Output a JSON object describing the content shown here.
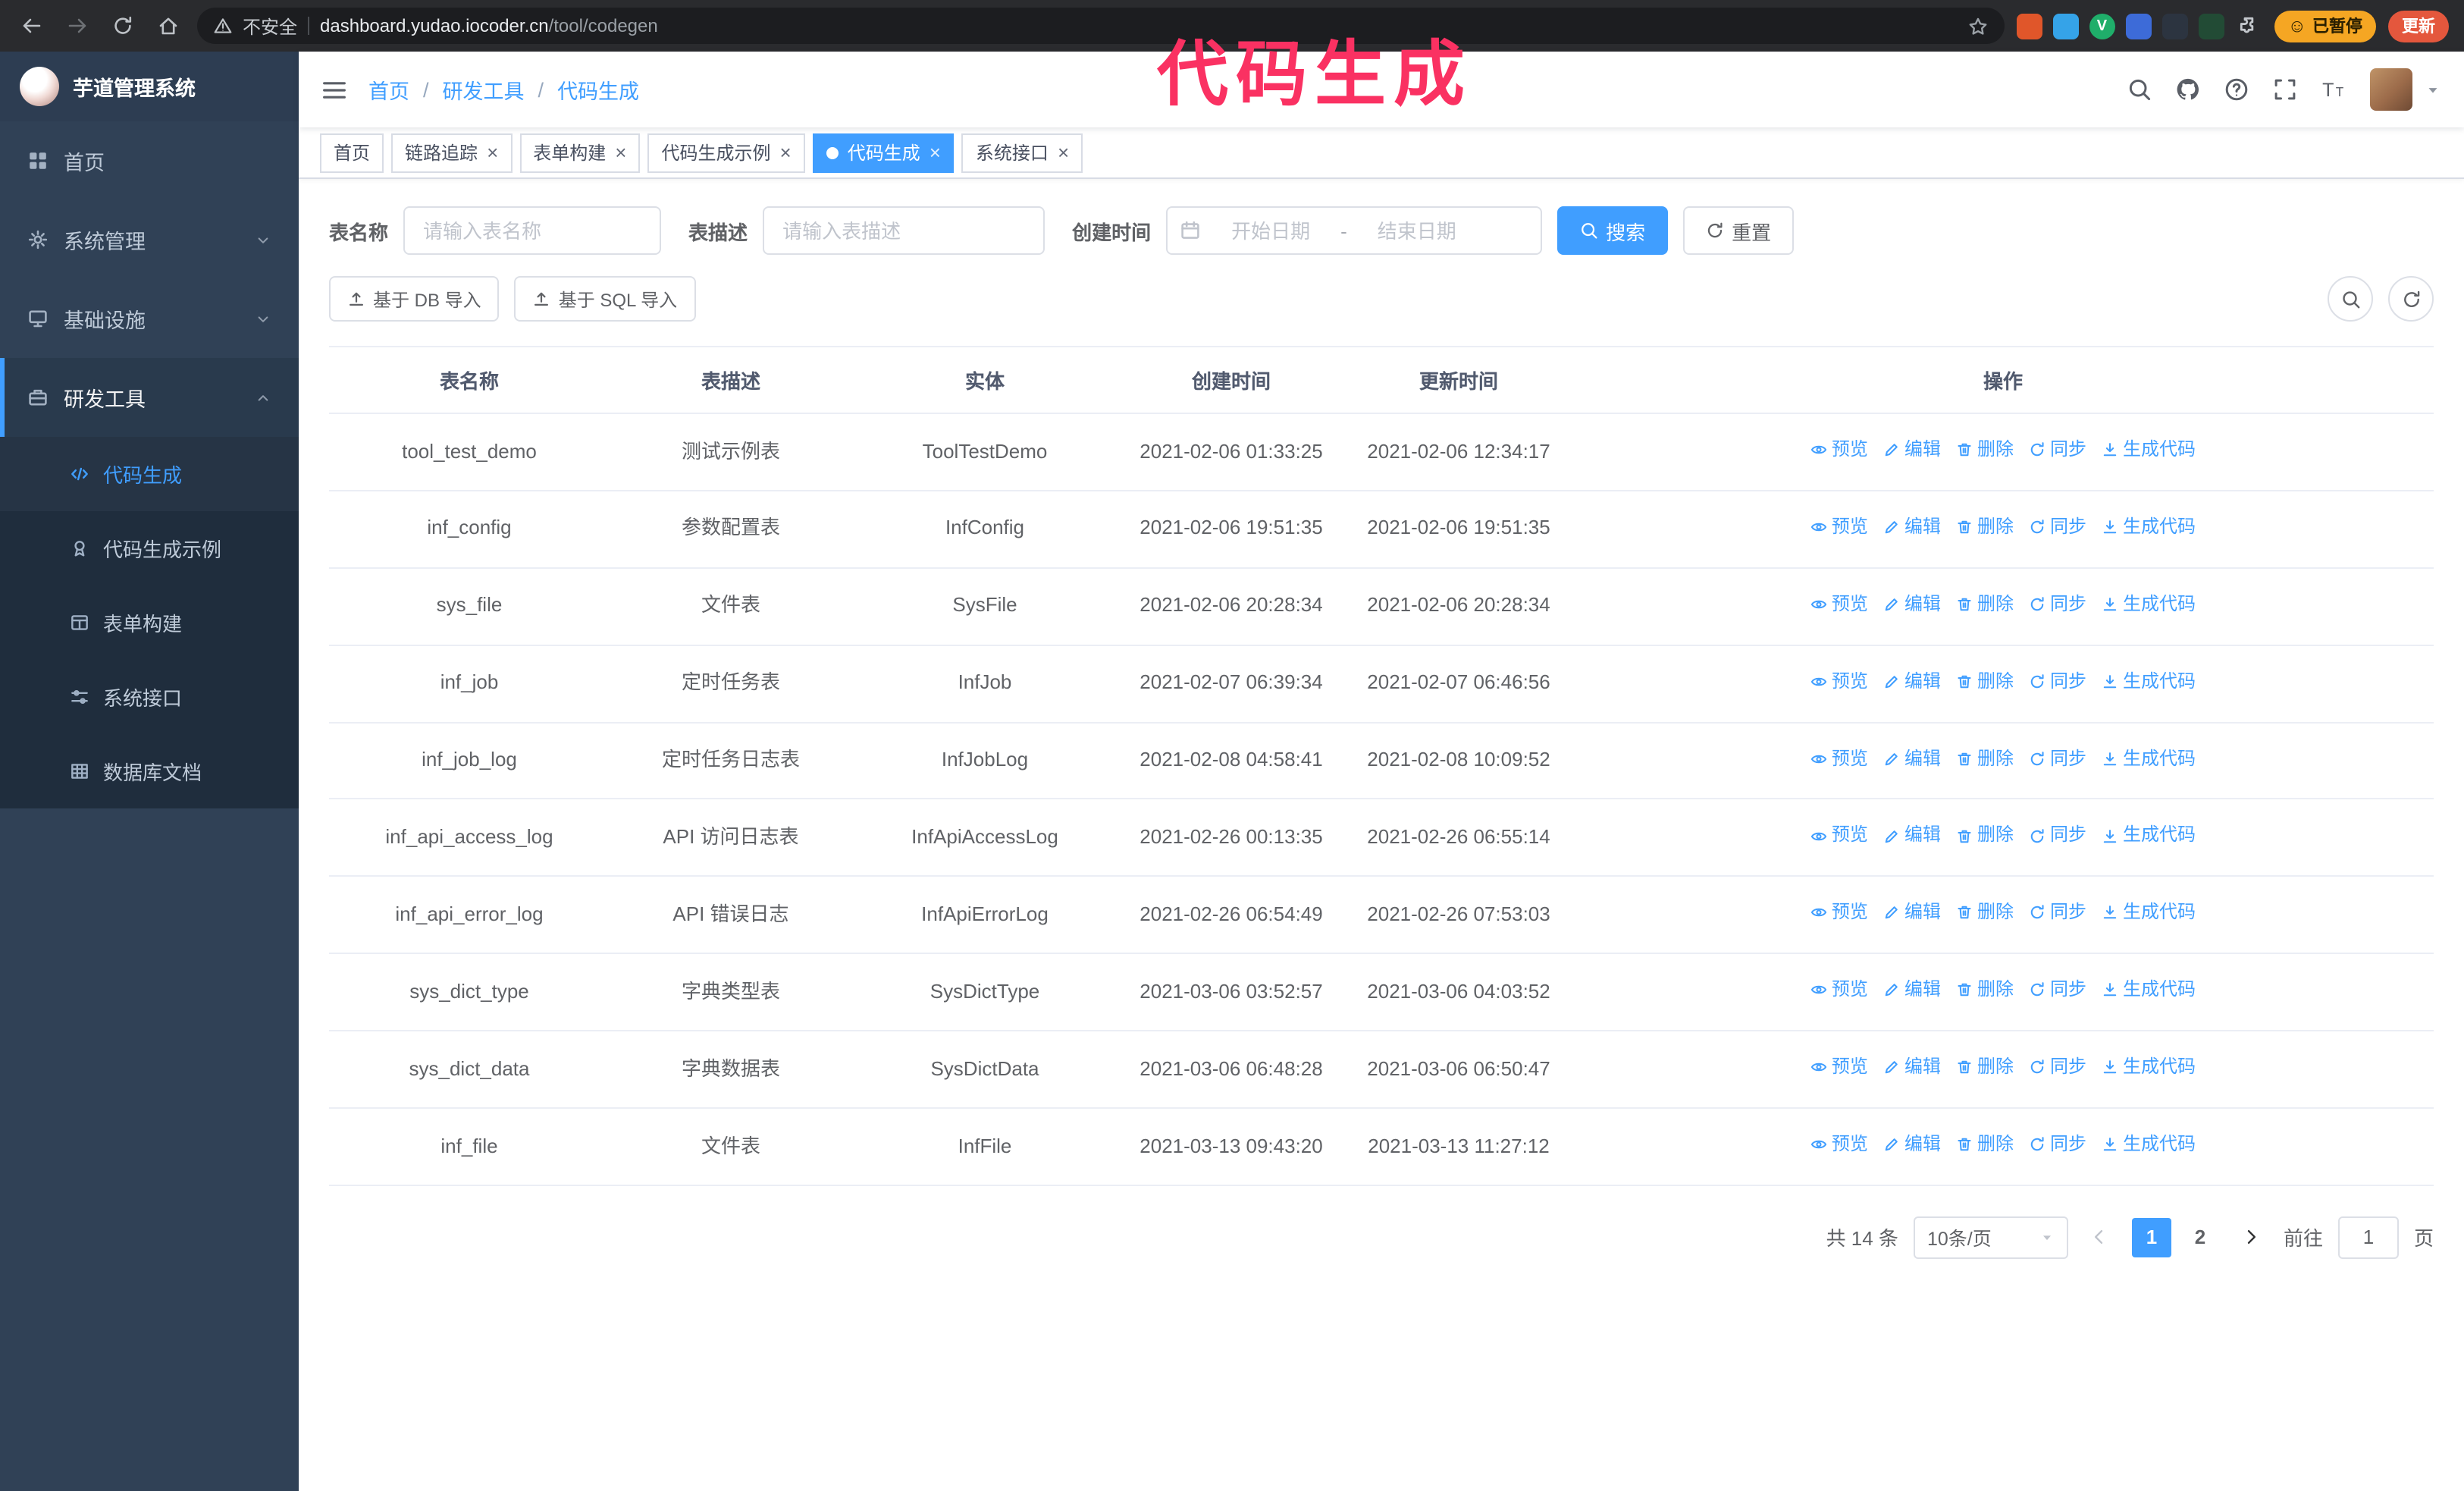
{
  "colors": {
    "accent": "#409eff",
    "sidebar_bg": "#304156",
    "submenu_bg": "#1f2d3d",
    "submenu_active_bg": "#263445",
    "chrome_bg": "#2a2b2e",
    "tag_active_bg": "#409eff",
    "paused_badge_bg": "#f5a623",
    "update_button_bg": "#e4573d",
    "annotation": "#fa3162"
  },
  "browser": {
    "security_label": "不安全",
    "url_host": "dashboard.yudao.iocoder.cn",
    "url_path": "/tool/codegen",
    "paused_badge": "已暂停",
    "paused_face_glyph": "☺",
    "update_label": "更新",
    "extensions": [
      {
        "id": "orange-lion",
        "bg": "#e0562a",
        "glyph": "",
        "round": false
      },
      {
        "id": "blue-tool",
        "bg": "#35a3e8",
        "glyph": "",
        "round": false
      },
      {
        "id": "green-v",
        "bg": "#1fae6a",
        "glyph": "V",
        "round": true
      },
      {
        "id": "blue-users",
        "bg": "#3d6bd8",
        "glyph": "",
        "round": false
      },
      {
        "id": "dark-chart",
        "bg": "#2c3440",
        "glyph": "",
        "round": false
      },
      {
        "id": "green-sprout",
        "bg": "#224b35",
        "glyph": "",
        "round": false
      }
    ]
  },
  "annotation": {
    "text": "代码生成"
  },
  "sidebar": {
    "logo_title": "芋道管理系统",
    "menu": [
      {
        "id": "home",
        "icon": "home-icon",
        "label": "首页"
      },
      {
        "id": "system",
        "icon": "gear-icon",
        "label": "系统管理",
        "chevron": "down"
      },
      {
        "id": "infra",
        "icon": "infra-icon",
        "label": "基础设施",
        "chevron": "down"
      },
      {
        "id": "devtools",
        "icon": "tools-icon",
        "label": "研发工具",
        "chevron": "up",
        "active": true,
        "children": [
          {
            "id": "codegen",
            "icon": "code-icon",
            "label": "代码生成",
            "active": true
          },
          {
            "id": "codegen-example",
            "icon": "badge-icon",
            "label": "代码生成示例"
          },
          {
            "id": "form-builder",
            "icon": "form-icon",
            "label": "表单构建"
          },
          {
            "id": "api",
            "icon": "sliders-icon",
            "label": "系统接口"
          },
          {
            "id": "db-doc",
            "icon": "db-icon",
            "label": "数据库文档"
          }
        ]
      }
    ]
  },
  "navbar": {
    "breadcrumb": [
      "首页",
      "研发工具",
      "代码生成"
    ]
  },
  "tags": [
    {
      "label": "首页",
      "closable": false,
      "active": false
    },
    {
      "label": "链路追踪",
      "closable": true,
      "active": false
    },
    {
      "label": "表单构建",
      "closable": true,
      "active": false
    },
    {
      "label": "代码生成示例",
      "closable": true,
      "active": false
    },
    {
      "label": "代码生成",
      "closable": true,
      "active": true
    },
    {
      "label": "系统接口",
      "closable": true,
      "active": false
    }
  ],
  "filters": {
    "table_name_label": "表名称",
    "table_name_placeholder": "请输入表名称",
    "table_desc_label": "表描述",
    "table_desc_placeholder": "请输入表描述",
    "created_label": "创建时间",
    "date_start_placeholder": "开始日期",
    "date_separator": "-",
    "date_end_placeholder": "结束日期",
    "search_label": "搜索",
    "reset_label": "重置"
  },
  "toolbar": {
    "import_db": "基于 DB 导入",
    "import_sql": "基于 SQL 导入"
  },
  "table": {
    "columns": [
      "表名称",
      "表描述",
      "实体",
      "创建时间",
      "更新时间",
      "操作"
    ],
    "row_actions": [
      {
        "id": "preview",
        "label": "预览",
        "icon": "eye-icon"
      },
      {
        "id": "edit",
        "label": "编辑",
        "icon": "edit-icon"
      },
      {
        "id": "delete",
        "label": "删除",
        "icon": "delete-icon"
      },
      {
        "id": "sync",
        "label": "同步",
        "icon": "sync-icon"
      },
      {
        "id": "generate",
        "label": "生成代码",
        "icon": "download-icon"
      }
    ],
    "rows": [
      {
        "name": "tool_test_demo",
        "desc": "测试示例表",
        "entity": "ToolTestDemo",
        "created": "2021-02-06 01:33:25",
        "updated": "2021-02-06 12:34:17"
      },
      {
        "name": "inf_config",
        "desc": "参数配置表",
        "entity": "InfConfig",
        "created": "2021-02-06 19:51:35",
        "updated": "2021-02-06 19:51:35"
      },
      {
        "name": "sys_file",
        "desc": "文件表",
        "entity": "SysFile",
        "created": "2021-02-06 20:28:34",
        "updated": "2021-02-06 20:28:34"
      },
      {
        "name": "inf_job",
        "desc": "定时任务表",
        "entity": "InfJob",
        "created": "2021-02-07 06:39:34",
        "updated": "2021-02-07 06:46:56"
      },
      {
        "name": "inf_job_log",
        "desc": "定时任务日志表",
        "entity": "InfJobLog",
        "created": "2021-02-08 04:58:41",
        "updated": "2021-02-08 10:09:52"
      },
      {
        "name": "inf_api_access_log",
        "desc": "API 访问日志表",
        "entity": "InfApiAccessLog",
        "created": "2021-02-26 00:13:35",
        "updated": "2021-02-26 06:55:14"
      },
      {
        "name": "inf_api_error_log",
        "desc": "API 错误日志",
        "entity": "InfApiErrorLog",
        "created": "2021-02-26 06:54:49",
        "updated": "2021-02-26 07:53:03"
      },
      {
        "name": "sys_dict_type",
        "desc": "字典类型表",
        "entity": "SysDictType",
        "created": "2021-03-06 03:52:57",
        "updated": "2021-03-06 04:03:52"
      },
      {
        "name": "sys_dict_data",
        "desc": "字典数据表",
        "entity": "SysDictData",
        "created": "2021-03-06 06:48:28",
        "updated": "2021-03-06 06:50:47"
      },
      {
        "name": "inf_file",
        "desc": "文件表",
        "entity": "InfFile",
        "created": "2021-03-13 09:43:20",
        "updated": "2021-03-13 11:27:12"
      }
    ]
  },
  "pagination": {
    "total": "共 14 条",
    "page_size": "10条/页",
    "pages": [
      "1",
      "2"
    ],
    "current": "1",
    "goto_prefix": "前往",
    "goto_value": "1",
    "goto_suffix": "页"
  }
}
